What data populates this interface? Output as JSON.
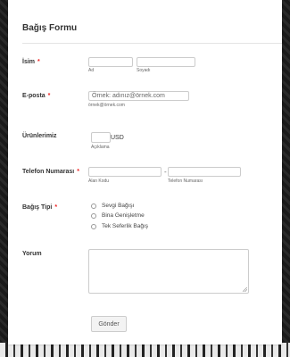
{
  "form": {
    "title": "Bağış Formu",
    "name": {
      "label": "İsim",
      "required_mark": "*",
      "first_sub": "Ad",
      "last_sub": "Soyadı"
    },
    "email": {
      "label": "E-posta",
      "required_mark": "*",
      "placeholder": "Örnek: adınız@örnek.com",
      "sub": "örnek@örnek.com"
    },
    "products": {
      "label": "Ürünlerimiz",
      "currency": "USD",
      "sub": "Açıklama"
    },
    "phone": {
      "label": "Telefon Numarası",
      "required_mark": "*",
      "area_sub": "Alan Kodu",
      "number_sub": "Telefon Numarası",
      "separator": "-"
    },
    "donation_type": {
      "label": "Bağış Tipi",
      "required_mark": "*",
      "options": [
        "Sevgi Bağışı",
        "Bina Genişletme",
        "Tek Seferlik Bağış"
      ]
    },
    "comment": {
      "label": "Yorum"
    },
    "submit_label": "Gönder"
  }
}
